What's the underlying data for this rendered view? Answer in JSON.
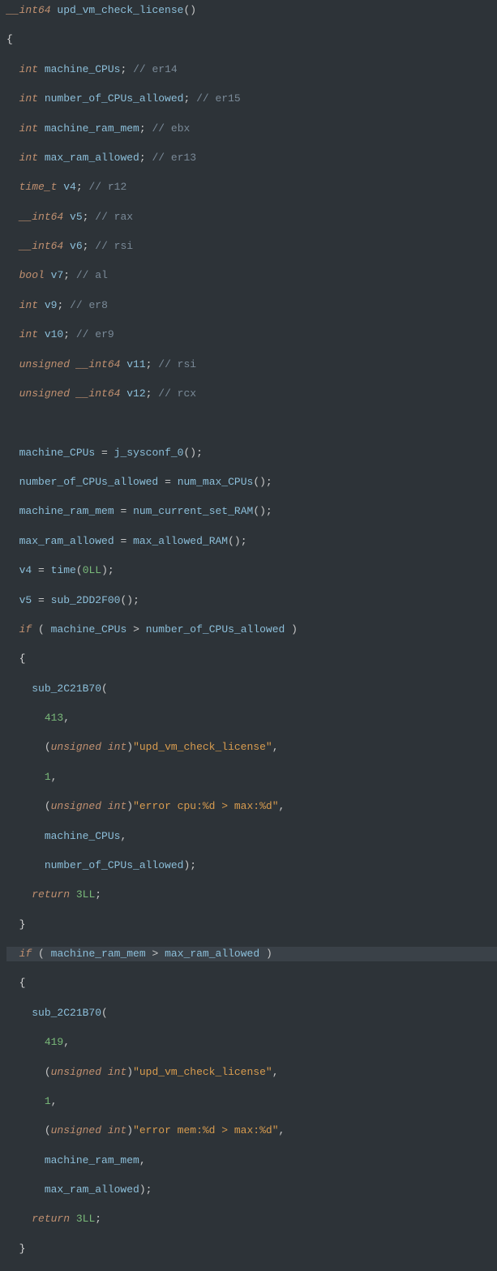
{
  "lines": [
    {
      "tokens": [
        {
          "t": "type",
          "s": "__int64"
        },
        {
          "t": "white",
          "s": " "
        },
        {
          "t": "func",
          "s": "upd_vm_check_license"
        },
        {
          "t": "paren",
          "s": "()"
        }
      ]
    },
    {
      "tokens": [
        {
          "t": "white",
          "s": "{"
        }
      ]
    },
    {
      "tokens": [
        {
          "t": "white",
          "s": "  "
        },
        {
          "t": "type",
          "s": "int"
        },
        {
          "t": "white",
          "s": " "
        },
        {
          "t": "var",
          "s": "machine_CPUs"
        },
        {
          "t": "punct",
          "s": ";"
        },
        {
          "t": "white",
          "s": " "
        },
        {
          "t": "comment",
          "s": "// er14"
        }
      ]
    },
    {
      "tokens": [
        {
          "t": "white",
          "s": "  "
        },
        {
          "t": "type",
          "s": "int"
        },
        {
          "t": "white",
          "s": " "
        },
        {
          "t": "var",
          "s": "number_of_CPUs_allowed"
        },
        {
          "t": "punct",
          "s": ";"
        },
        {
          "t": "white",
          "s": " "
        },
        {
          "t": "comment",
          "s": "// er15"
        }
      ]
    },
    {
      "tokens": [
        {
          "t": "white",
          "s": "  "
        },
        {
          "t": "type",
          "s": "int"
        },
        {
          "t": "white",
          "s": " "
        },
        {
          "t": "var",
          "s": "machine_ram_mem"
        },
        {
          "t": "punct",
          "s": ";"
        },
        {
          "t": "white",
          "s": " "
        },
        {
          "t": "comment",
          "s": "// ebx"
        }
      ]
    },
    {
      "tokens": [
        {
          "t": "white",
          "s": "  "
        },
        {
          "t": "type",
          "s": "int"
        },
        {
          "t": "white",
          "s": " "
        },
        {
          "t": "var",
          "s": "max_ram_allowed"
        },
        {
          "t": "punct",
          "s": ";"
        },
        {
          "t": "white",
          "s": " "
        },
        {
          "t": "comment",
          "s": "// er13"
        }
      ]
    },
    {
      "tokens": [
        {
          "t": "white",
          "s": "  "
        },
        {
          "t": "type",
          "s": "time_t"
        },
        {
          "t": "white",
          "s": " "
        },
        {
          "t": "var",
          "s": "v4"
        },
        {
          "t": "punct",
          "s": ";"
        },
        {
          "t": "white",
          "s": " "
        },
        {
          "t": "comment",
          "s": "// r12"
        }
      ]
    },
    {
      "tokens": [
        {
          "t": "white",
          "s": "  "
        },
        {
          "t": "type",
          "s": "__int64"
        },
        {
          "t": "white",
          "s": " "
        },
        {
          "t": "var",
          "s": "v5"
        },
        {
          "t": "punct",
          "s": ";"
        },
        {
          "t": "white",
          "s": " "
        },
        {
          "t": "comment",
          "s": "// rax"
        }
      ]
    },
    {
      "tokens": [
        {
          "t": "white",
          "s": "  "
        },
        {
          "t": "type",
          "s": "__int64"
        },
        {
          "t": "white",
          "s": " "
        },
        {
          "t": "var",
          "s": "v6"
        },
        {
          "t": "punct",
          "s": ";"
        },
        {
          "t": "white",
          "s": " "
        },
        {
          "t": "comment",
          "s": "// rsi"
        }
      ]
    },
    {
      "tokens": [
        {
          "t": "white",
          "s": "  "
        },
        {
          "t": "type",
          "s": "bool"
        },
        {
          "t": "white",
          "s": " "
        },
        {
          "t": "var",
          "s": "v7"
        },
        {
          "t": "punct",
          "s": ";"
        },
        {
          "t": "white",
          "s": " "
        },
        {
          "t": "comment",
          "s": "// al"
        }
      ]
    },
    {
      "tokens": [
        {
          "t": "white",
          "s": "  "
        },
        {
          "t": "type",
          "s": "int"
        },
        {
          "t": "white",
          "s": " "
        },
        {
          "t": "var",
          "s": "v9"
        },
        {
          "t": "punct",
          "s": ";"
        },
        {
          "t": "white",
          "s": " "
        },
        {
          "t": "comment",
          "s": "// er8"
        }
      ]
    },
    {
      "tokens": [
        {
          "t": "white",
          "s": "  "
        },
        {
          "t": "type",
          "s": "int"
        },
        {
          "t": "white",
          "s": " "
        },
        {
          "t": "var",
          "s": "v10"
        },
        {
          "t": "punct",
          "s": ";"
        },
        {
          "t": "white",
          "s": " "
        },
        {
          "t": "comment",
          "s": "// er9"
        }
      ]
    },
    {
      "tokens": [
        {
          "t": "white",
          "s": "  "
        },
        {
          "t": "type",
          "s": "unsigned __int64"
        },
        {
          "t": "white",
          "s": " "
        },
        {
          "t": "var",
          "s": "v11"
        },
        {
          "t": "punct",
          "s": ";"
        },
        {
          "t": "white",
          "s": " "
        },
        {
          "t": "comment",
          "s": "// rsi"
        }
      ]
    },
    {
      "tokens": [
        {
          "t": "white",
          "s": "  "
        },
        {
          "t": "type",
          "s": "unsigned __int64"
        },
        {
          "t": "white",
          "s": " "
        },
        {
          "t": "var",
          "s": "v12"
        },
        {
          "t": "punct",
          "s": ";"
        },
        {
          "t": "white",
          "s": " "
        },
        {
          "t": "comment",
          "s": "// rcx"
        }
      ]
    },
    {
      "tokens": []
    },
    {
      "tokens": [
        {
          "t": "white",
          "s": "  "
        },
        {
          "t": "var",
          "s": "machine_CPUs"
        },
        {
          "t": "white",
          "s": " "
        },
        {
          "t": "punct",
          "s": "="
        },
        {
          "t": "white",
          "s": " "
        },
        {
          "t": "func",
          "s": "j_sysconf_0"
        },
        {
          "t": "paren",
          "s": "();"
        }
      ]
    },
    {
      "tokens": [
        {
          "t": "white",
          "s": "  "
        },
        {
          "t": "var",
          "s": "number_of_CPUs_allowed"
        },
        {
          "t": "white",
          "s": " "
        },
        {
          "t": "punct",
          "s": "="
        },
        {
          "t": "white",
          "s": " "
        },
        {
          "t": "func",
          "s": "num_max_CPUs"
        },
        {
          "t": "paren",
          "s": "();"
        }
      ]
    },
    {
      "tokens": [
        {
          "t": "white",
          "s": "  "
        },
        {
          "t": "var",
          "s": "machine_ram_mem"
        },
        {
          "t": "white",
          "s": " "
        },
        {
          "t": "punct",
          "s": "="
        },
        {
          "t": "white",
          "s": " "
        },
        {
          "t": "func",
          "s": "num_current_set_RAM"
        },
        {
          "t": "paren",
          "s": "();"
        }
      ]
    },
    {
      "tokens": [
        {
          "t": "white",
          "s": "  "
        },
        {
          "t": "var",
          "s": "max_ram_allowed"
        },
        {
          "t": "white",
          "s": " "
        },
        {
          "t": "punct",
          "s": "="
        },
        {
          "t": "white",
          "s": " "
        },
        {
          "t": "func",
          "s": "max_allowed_RAM"
        },
        {
          "t": "paren",
          "s": "();"
        }
      ]
    },
    {
      "tokens": [
        {
          "t": "white",
          "s": "  "
        },
        {
          "t": "var",
          "s": "v4"
        },
        {
          "t": "white",
          "s": " "
        },
        {
          "t": "punct",
          "s": "="
        },
        {
          "t": "white",
          "s": " "
        },
        {
          "t": "func",
          "s": "time"
        },
        {
          "t": "paren",
          "s": "("
        },
        {
          "t": "number",
          "s": "0LL"
        },
        {
          "t": "paren",
          "s": ");"
        }
      ]
    },
    {
      "tokens": [
        {
          "t": "white",
          "s": "  "
        },
        {
          "t": "var",
          "s": "v5"
        },
        {
          "t": "white",
          "s": " "
        },
        {
          "t": "punct",
          "s": "="
        },
        {
          "t": "white",
          "s": " "
        },
        {
          "t": "func",
          "s": "sub_2DD2F00"
        },
        {
          "t": "paren",
          "s": "();"
        }
      ]
    },
    {
      "tokens": [
        {
          "t": "white",
          "s": "  "
        },
        {
          "t": "keyword",
          "s": "if"
        },
        {
          "t": "white",
          "s": " "
        },
        {
          "t": "paren",
          "s": "( "
        },
        {
          "t": "var",
          "s": "machine_CPUs"
        },
        {
          "t": "white",
          "s": " "
        },
        {
          "t": "punct",
          "s": ">"
        },
        {
          "t": "white",
          "s": " "
        },
        {
          "t": "var",
          "s": "number_of_CPUs_allowed"
        },
        {
          "t": "paren",
          "s": " )"
        }
      ]
    },
    {
      "tokens": [
        {
          "t": "white",
          "s": "  {"
        }
      ]
    },
    {
      "tokens": [
        {
          "t": "white",
          "s": "    "
        },
        {
          "t": "func",
          "s": "sub_2C21B70"
        },
        {
          "t": "paren",
          "s": "("
        }
      ]
    },
    {
      "tokens": [
        {
          "t": "white",
          "s": "      "
        },
        {
          "t": "number",
          "s": "413"
        },
        {
          "t": "punct",
          "s": ","
        }
      ]
    },
    {
      "tokens": [
        {
          "t": "white",
          "s": "      "
        },
        {
          "t": "paren",
          "s": "("
        },
        {
          "t": "type",
          "s": "unsigned int"
        },
        {
          "t": "paren",
          "s": ")"
        },
        {
          "t": "string",
          "s": "\"upd_vm_check_license\""
        },
        {
          "t": "punct",
          "s": ","
        }
      ]
    },
    {
      "tokens": [
        {
          "t": "white",
          "s": "      "
        },
        {
          "t": "number",
          "s": "1"
        },
        {
          "t": "punct",
          "s": ","
        }
      ]
    },
    {
      "tokens": [
        {
          "t": "white",
          "s": "      "
        },
        {
          "t": "paren",
          "s": "("
        },
        {
          "t": "type",
          "s": "unsigned int"
        },
        {
          "t": "paren",
          "s": ")"
        },
        {
          "t": "string",
          "s": "\"error cpu:%d > max:%d\""
        },
        {
          "t": "punct",
          "s": ","
        }
      ]
    },
    {
      "tokens": [
        {
          "t": "white",
          "s": "      "
        },
        {
          "t": "var",
          "s": "machine_CPUs"
        },
        {
          "t": "punct",
          "s": ","
        }
      ]
    },
    {
      "tokens": [
        {
          "t": "white",
          "s": "      "
        },
        {
          "t": "var",
          "s": "number_of_CPUs_allowed"
        },
        {
          "t": "paren",
          "s": ");"
        }
      ]
    },
    {
      "tokens": [
        {
          "t": "white",
          "s": "    "
        },
        {
          "t": "keyword",
          "s": "return"
        },
        {
          "t": "white",
          "s": " "
        },
        {
          "t": "number",
          "s": "3LL"
        },
        {
          "t": "punct",
          "s": ";"
        }
      ]
    },
    {
      "tokens": [
        {
          "t": "white",
          "s": "  }"
        }
      ]
    },
    {
      "hl": true,
      "tokens": [
        {
          "t": "white",
          "s": "  "
        },
        {
          "t": "keyword",
          "s": "if"
        },
        {
          "t": "white",
          "s": " "
        },
        {
          "t": "paren",
          "s": "( "
        },
        {
          "t": "var",
          "s": "machine_ram_mem"
        },
        {
          "t": "white",
          "s": " "
        },
        {
          "t": "punct",
          "s": ">"
        },
        {
          "t": "white",
          "s": " "
        },
        {
          "t": "var",
          "s": "max_ram_allowed"
        },
        {
          "t": "paren",
          "s": " )"
        }
      ]
    },
    {
      "tokens": [
        {
          "t": "white",
          "s": "  {"
        }
      ]
    },
    {
      "tokens": [
        {
          "t": "white",
          "s": "    "
        },
        {
          "t": "func",
          "s": "sub_2C21B70"
        },
        {
          "t": "paren",
          "s": "("
        }
      ]
    },
    {
      "tokens": [
        {
          "t": "white",
          "s": "      "
        },
        {
          "t": "number",
          "s": "419"
        },
        {
          "t": "punct",
          "s": ","
        }
      ]
    },
    {
      "tokens": [
        {
          "t": "white",
          "s": "      "
        },
        {
          "t": "paren",
          "s": "("
        },
        {
          "t": "type",
          "s": "unsigned int"
        },
        {
          "t": "paren",
          "s": ")"
        },
        {
          "t": "string",
          "s": "\"upd_vm_check_license\""
        },
        {
          "t": "punct",
          "s": ","
        }
      ]
    },
    {
      "tokens": [
        {
          "t": "white",
          "s": "      "
        },
        {
          "t": "number",
          "s": "1"
        },
        {
          "t": "punct",
          "s": ","
        }
      ]
    },
    {
      "tokens": [
        {
          "t": "white",
          "s": "      "
        },
        {
          "t": "paren",
          "s": "("
        },
        {
          "t": "type",
          "s": "unsigned int"
        },
        {
          "t": "paren",
          "s": ")"
        },
        {
          "t": "string",
          "s": "\"error mem:%d > max:%d\""
        },
        {
          "t": "punct",
          "s": ","
        }
      ]
    },
    {
      "tokens": [
        {
          "t": "white",
          "s": "      "
        },
        {
          "t": "var",
          "s": "machine_ram_mem"
        },
        {
          "t": "punct",
          "s": ","
        }
      ]
    },
    {
      "tokens": [
        {
          "t": "white",
          "s": "      "
        },
        {
          "t": "var",
          "s": "max_ram_allowed"
        },
        {
          "t": "paren",
          "s": ");"
        }
      ]
    },
    {
      "tokens": [
        {
          "t": "white",
          "s": "    "
        },
        {
          "t": "keyword",
          "s": "return"
        },
        {
          "t": "white",
          "s": " "
        },
        {
          "t": "number",
          "s": "3LL"
        },
        {
          "t": "punct",
          "s": ";"
        }
      ]
    },
    {
      "tokens": [
        {
          "t": "white",
          "s": "  }"
        }
      ]
    }
  ]
}
